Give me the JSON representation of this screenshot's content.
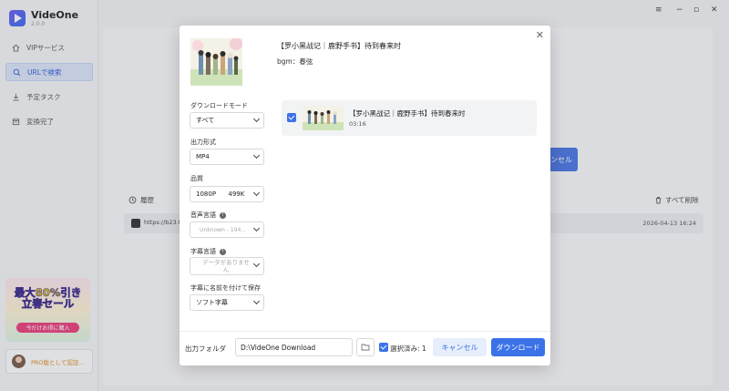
{
  "app": {
    "name": "VideOne",
    "version": "2.0.0",
    "accent": "#3b72e8"
  },
  "sidebar": {
    "items": [
      {
        "label": "VIPサービス",
        "icon": "home-icon"
      },
      {
        "label": "URLで検索",
        "icon": "search-icon",
        "active": true
      },
      {
        "label": "予定タスク",
        "icon": "download-icon"
      },
      {
        "label": "変換完了",
        "icon": "archive-icon"
      }
    ],
    "promo": {
      "title_line1": "最大80%引き",
      "title_line2": "立春セール",
      "button": "今だけお得に購入"
    },
    "pro_label": "PRO版として認証..."
  },
  "window_controls": [
    "≡",
    "−",
    "▫",
    "✕"
  ],
  "background": {
    "cancel_button_partial": "ンセル",
    "history_label": "履歴",
    "delete_all": "すべて削除",
    "history_rows": [
      {
        "url": "https://b23.tv",
        "date": "2026-04-13 16:24"
      }
    ]
  },
  "dialog": {
    "title": "【罗小黑战记｜鹿野手书】待到春来时",
    "subtitle": "bgm：春弦",
    "options": {
      "download_mode": {
        "label": "ダウンロードモード",
        "value": "すべて"
      },
      "output_format": {
        "label": "出力形式",
        "value": "MP4"
      },
      "quality": {
        "label": "品質",
        "value": "1080P      499K"
      },
      "audio_language": {
        "label": "音声言語",
        "value": "Unknown - 194..."
      },
      "subtitle_language": {
        "label": "字幕言語",
        "value": "データがありません"
      },
      "subtitle_save": {
        "label": "字幕に名前を付けて保存",
        "value": "ソフト字幕"
      }
    },
    "items": [
      {
        "title": "【罗小黑战记｜鹿野手书】待到春来时",
        "duration": "03:16",
        "checked": true
      }
    ],
    "footer": {
      "output_label": "出力フォルダ",
      "output_path": "D:\\VideOne Download",
      "selected_count": "選択済み: 1",
      "cancel": "キャンセル",
      "download": "ダウンロード"
    }
  }
}
